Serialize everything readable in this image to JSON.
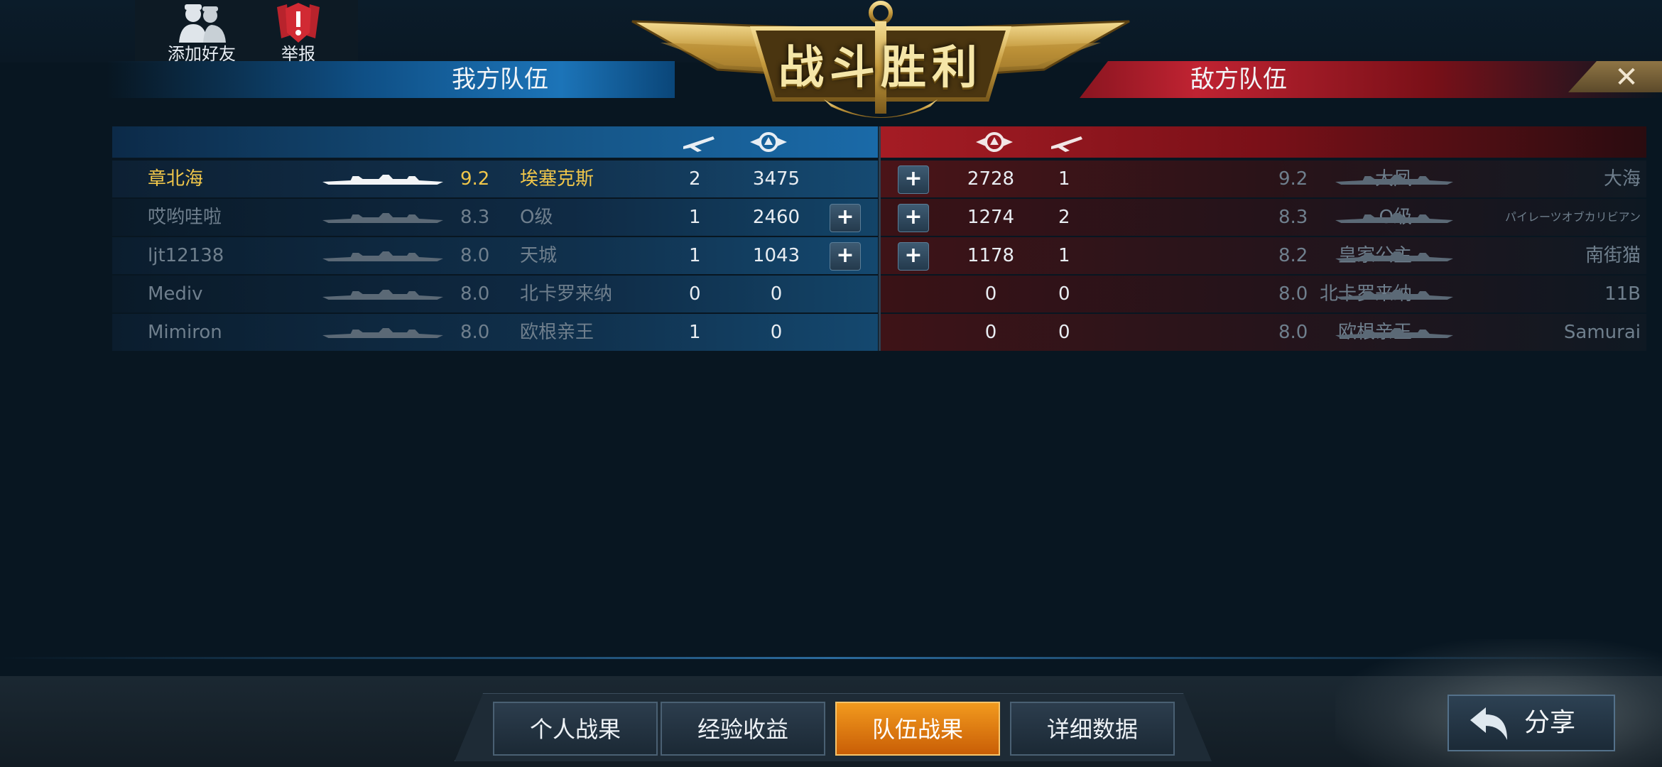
{
  "top_buttons": {
    "add_friend": "添加好友",
    "report": "举报"
  },
  "header": {
    "title": "战斗胜利",
    "ally_team": "我方队伍",
    "enemy_team": "敌方队伍",
    "close": "✕"
  },
  "ally_rows": [
    {
      "player": "章北海",
      "rating": "9.2",
      "ship": "埃塞克斯",
      "kills": "2",
      "score": "3475",
      "highlight": true,
      "plus": false
    },
    {
      "player": "哎哟哇啦",
      "rating": "8.3",
      "ship": "O级",
      "kills": "1",
      "score": "2460",
      "highlight": false,
      "plus": true
    },
    {
      "player": "ljt12138",
      "rating": "8.0",
      "ship": "天城",
      "kills": "1",
      "score": "1043",
      "highlight": false,
      "plus": true
    },
    {
      "player": "Mediv",
      "rating": "8.0",
      "ship": "北卡罗来纳",
      "kills": "0",
      "score": "0",
      "highlight": false,
      "plus": false
    },
    {
      "player": "Mimiron",
      "rating": "8.0",
      "ship": "欧根亲王",
      "kills": "1",
      "score": "0",
      "highlight": false,
      "plus": false
    }
  ],
  "enemy_rows": [
    {
      "score": "2728",
      "kills": "1",
      "ship": "大凤",
      "rating": "9.2",
      "player": "大海",
      "plus": true
    },
    {
      "score": "1274",
      "kills": "2",
      "ship": "O级",
      "rating": "8.3",
      "player": "パイレーツオブカリビアン",
      "plus": true
    },
    {
      "score": "1178",
      "kills": "1",
      "ship": "皇家公主",
      "rating": "8.2",
      "player": "南街猫",
      "plus": true
    },
    {
      "score": "0",
      "kills": "0",
      "ship": "北卡罗来纳",
      "rating": "8.0",
      "player": "11B",
      "plus": false
    },
    {
      "score": "0",
      "kills": "0",
      "ship": "欧根亲王",
      "rating": "8.0",
      "player": "Samurai",
      "plus": false
    }
  ],
  "tabs": [
    "个人战果",
    "经验收益",
    "队伍战果",
    "详细数据"
  ],
  "active_tab": "队伍战果",
  "share": "分享",
  "colors": {
    "ally": "#1c74b8",
    "enemy": "#c02332",
    "highlight": "#f0c64a",
    "active_tab": "#f29a1e"
  }
}
